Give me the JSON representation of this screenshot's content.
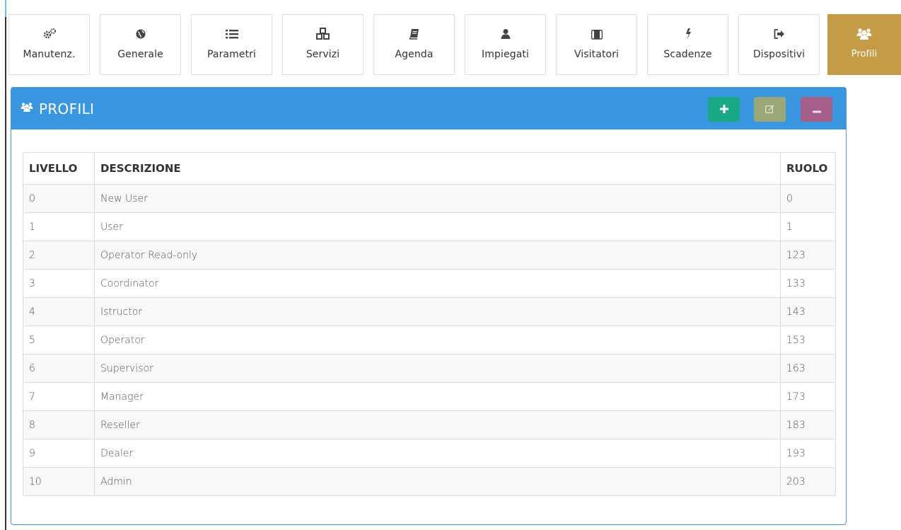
{
  "nav": [
    {
      "label": "Manutenz.",
      "icon": "gears-icon"
    },
    {
      "label": "Generale",
      "icon": "globe-icon"
    },
    {
      "label": "Parametri",
      "icon": "list-icon"
    },
    {
      "label": "Servizi",
      "icon": "cubes-icon"
    },
    {
      "label": "Agenda",
      "icon": "book-icon"
    },
    {
      "label": "Impiegati",
      "icon": "user-icon"
    },
    {
      "label": "Visitatori",
      "icon": "badge-icon"
    },
    {
      "label": "Scadenze",
      "icon": "bolt-icon"
    },
    {
      "label": "Dispositivi",
      "icon": "sign-out-icon"
    },
    {
      "label": "Profili",
      "icon": "users-icon",
      "active": true
    }
  ],
  "colors": {
    "accent": "#3a96de",
    "active_tile": "#c49c48",
    "add": "#1ba886",
    "edit": "#99a878",
    "delete": "#a65f8a"
  },
  "panel": {
    "title": "PROFILI",
    "buttons": {
      "add": "add-icon",
      "edit": "edit-icon",
      "delete": "remove-icon"
    }
  },
  "table": {
    "headers": [
      "LIVELLO",
      "DESCRIZIONE",
      "RUOLO"
    ],
    "rows": [
      {
        "livello": "0",
        "descrizione": "New User",
        "ruolo": "0"
      },
      {
        "livello": "1",
        "descrizione": "User",
        "ruolo": "1"
      },
      {
        "livello": "2",
        "descrizione": "Operator Read-only",
        "ruolo": "123"
      },
      {
        "livello": "3",
        "descrizione": "Coordinator",
        "ruolo": "133"
      },
      {
        "livello": "4",
        "descrizione": "Istructor",
        "ruolo": "143"
      },
      {
        "livello": "5",
        "descrizione": "Operator",
        "ruolo": "153"
      },
      {
        "livello": "6",
        "descrizione": "Supervisor",
        "ruolo": "163"
      },
      {
        "livello": "7",
        "descrizione": "Manager",
        "ruolo": "173"
      },
      {
        "livello": "8",
        "descrizione": "Reseller",
        "ruolo": "183"
      },
      {
        "livello": "9",
        "descrizione": "Dealer",
        "ruolo": "193"
      },
      {
        "livello": "10",
        "descrizione": "Admin",
        "ruolo": "203"
      }
    ]
  }
}
